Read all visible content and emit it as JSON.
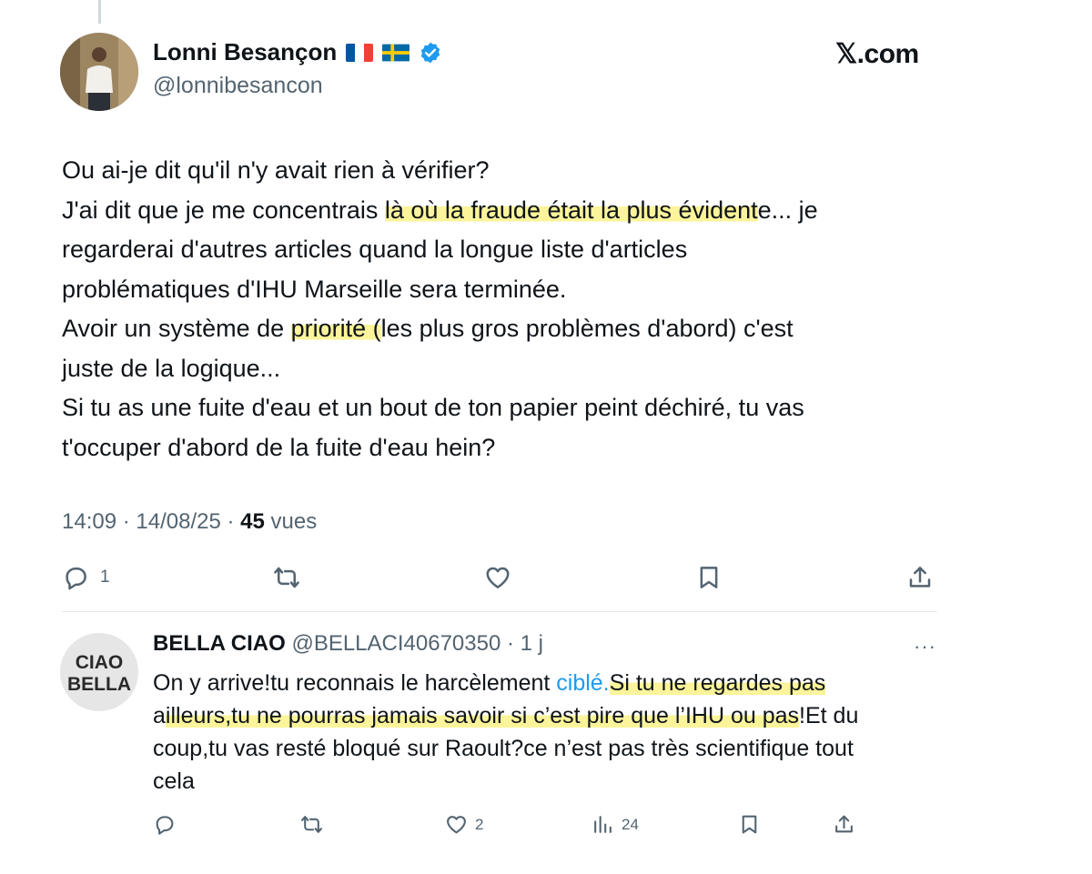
{
  "tweet": {
    "author_name": "Lonni Besançon",
    "author_handle": "@lonnibesancon",
    "site": "𝕏.com",
    "body": {
      "l1": "Ou ai-je dit qu'il n'y avait rien à vérifier?",
      "l2_a": "J'ai dit que je me concentrais ",
      "l2_hl": "là où la fraude était la plus évident",
      "l2_b": "e... je",
      "l3": "regarderai d'autres articles quand la longue liste d'articles",
      "l4": "problématiques d'IHU Marseille sera terminée.",
      "l5_a": "Avoir un système de ",
      "l5_hl": "priorité (",
      "l5_b": "les plus gros problèmes d'abord) c'est",
      "l6": "juste de la logique...",
      "l7": "Si tu as une fuite d'eau et un bout de ton papier peint déchiré, tu vas",
      "l8": "t'occuper d'abord de la fuite d'eau hein?"
    },
    "time": "14:09 · 14/08/25 · ",
    "views_count": "45",
    "views_label": " vues",
    "replies_count": "1"
  },
  "reply": {
    "author_name": "BELLA CIAO",
    "author_handle": " @BELLACI40670350 · 1 j",
    "more": "···",
    "avatar_line1": "CIAO",
    "avatar_line2": "BELLA",
    "body": {
      "a": "On y arrive!tu reconnais le harcèlement ",
      "link": "ciblé.",
      "hl1": "Si tu ne regardes pas",
      "b": "a",
      "hl2": "illeurs,tu ne pourras jamais savoir si c’est pire que l’IHU ou pas",
      "c": "!Et du",
      "d": "coup,tu vas resté bloqué sur Raoult?ce n’est pas très scientifique tout",
      "e": "cela"
    },
    "likes_count": "2",
    "views_count": "24"
  },
  "colors": {
    "highlight": "#fbf49a",
    "link": "#1d9bf0",
    "verified": "#1d9bf0",
    "secondary_text": "#536471"
  },
  "icons": [
    "reply-icon",
    "retweet-icon",
    "like-icon",
    "bookmark-icon",
    "share-icon",
    "views-icon",
    "verified-badge-icon",
    "flag-france-icon",
    "flag-sweden-icon",
    "more-icon"
  ]
}
